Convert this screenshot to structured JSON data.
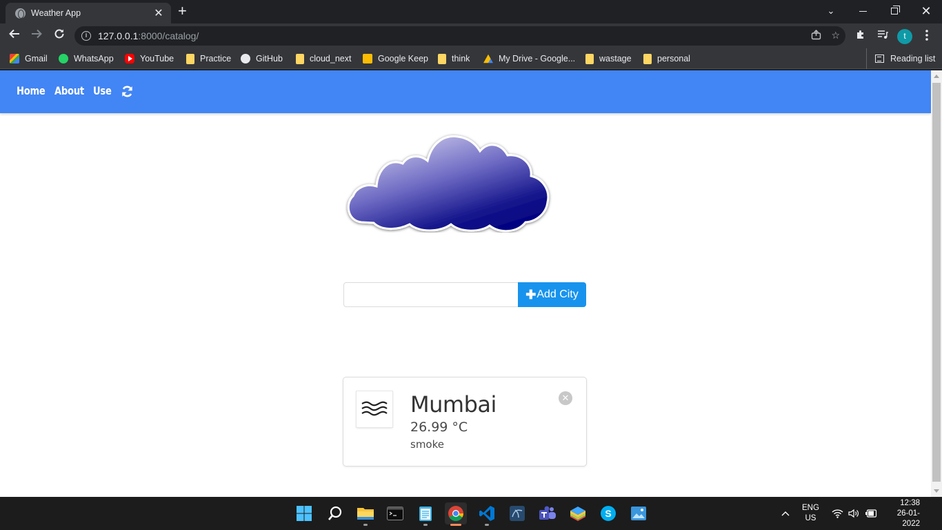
{
  "browser": {
    "tab_title": "Weather App",
    "url_host": "127.0.0.1",
    "url_rest": ":8000/catalog/",
    "bookmarks": [
      {
        "label": "Gmail",
        "icon": "gmail-icon"
      },
      {
        "label": "WhatsApp",
        "icon": "whatsapp-icon"
      },
      {
        "label": "YouTube",
        "icon": "youtube-icon"
      },
      {
        "label": "Practice",
        "icon": "folder-icon"
      },
      {
        "label": "GitHub",
        "icon": "github-icon"
      },
      {
        "label": "cloud_next",
        "icon": "folder-icon"
      },
      {
        "label": "Google Keep",
        "icon": "keep-icon"
      },
      {
        "label": "think",
        "icon": "folder-icon"
      },
      {
        "label": "My Drive - Google...",
        "icon": "drive-icon"
      },
      {
        "label": "wastage",
        "icon": "folder-icon"
      },
      {
        "label": "personal",
        "icon": "folder-icon"
      }
    ],
    "reading_list": "Reading list",
    "profile_initial": "t"
  },
  "site": {
    "nav": {
      "home": "Home",
      "about": "About",
      "use": "Use"
    },
    "colors": {
      "nav_bg": "#4285f4",
      "button_bg": "#1893ed"
    },
    "search": {
      "value": "",
      "placeholder": "",
      "button_label": "Add City"
    },
    "cards": [
      {
        "city": "Mumbai",
        "temperature": "26.99 °C",
        "description": "smoke",
        "icon": "haze-icon"
      }
    ]
  },
  "taskbar": {
    "language_line1": "ENG",
    "language_line2": "US",
    "time": "12:38",
    "date": "26-01-2022"
  }
}
